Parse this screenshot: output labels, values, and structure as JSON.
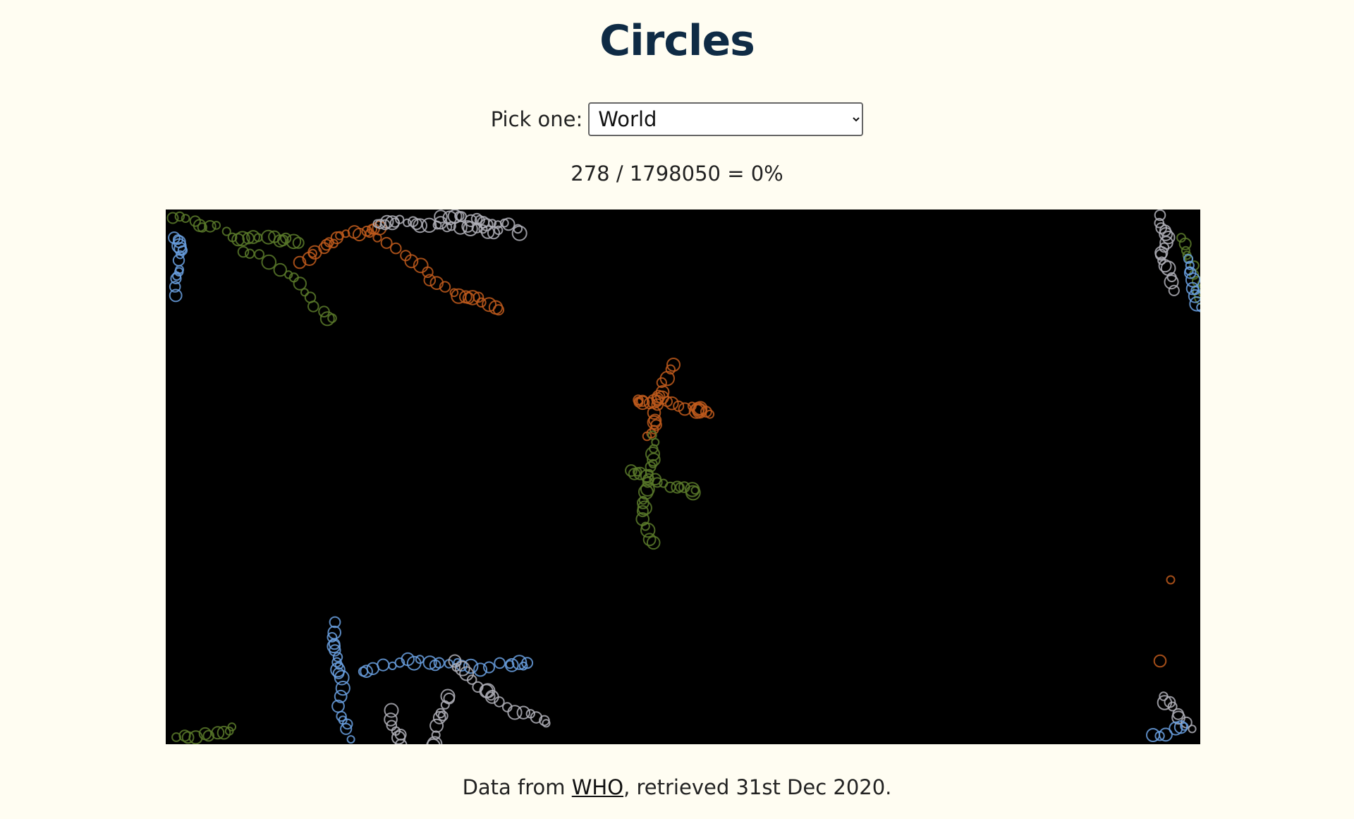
{
  "header": {
    "title": "Circles"
  },
  "picker": {
    "label": "Pick one:",
    "selected": "World",
    "options": [
      "World"
    ]
  },
  "stats": {
    "count": "278",
    "total": "1798050",
    "percent": "0%"
  },
  "footer": {
    "prefix": "Data from ",
    "link_text": "WHO",
    "suffix": ", retrieved 31st Dec 2020."
  },
  "colors": {
    "background": "#fffdf2",
    "title": "#0f2b45",
    "canvas": "#000000",
    "ring_palette": [
      "#b0b0b8",
      "#c05a1c",
      "#5a7a2a",
      "#6aa0e0"
    ]
  }
}
